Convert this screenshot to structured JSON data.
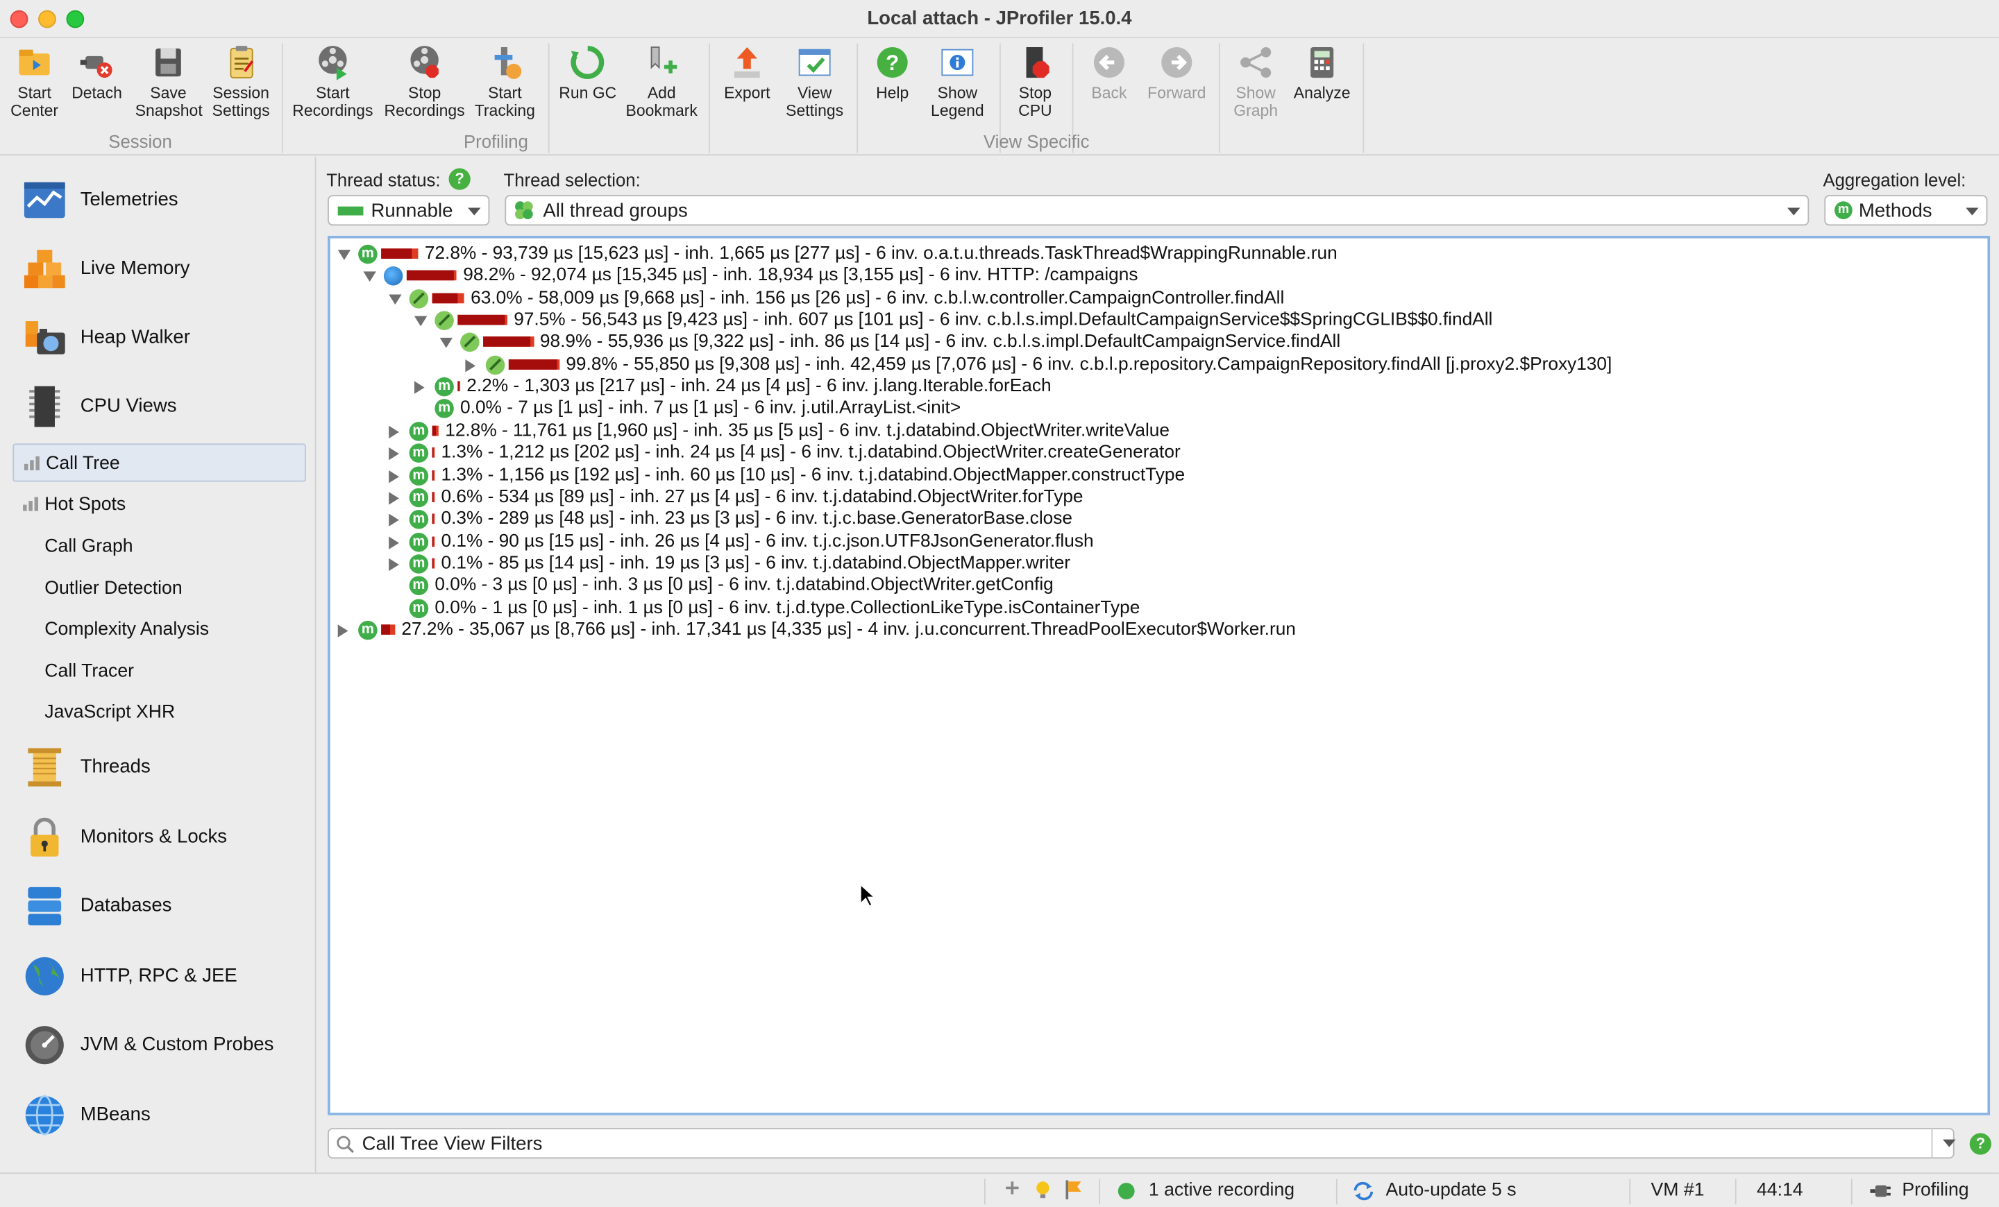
{
  "window": {
    "title": "Local attach - JProfiler 15.0.4"
  },
  "toolbar": {
    "buttons": [
      {
        "label": "Start\nCenter",
        "icon": "folder-icon"
      },
      {
        "label": "Detach",
        "icon": "detach-plug-icon"
      },
      {
        "label": "Save\nSnapshot",
        "icon": "save-disk-icon"
      },
      {
        "label": "Session\nSettings",
        "icon": "settings-clipboard-icon"
      },
      {
        "label": "Start\nRecordings",
        "icon": "film-reel-icon"
      },
      {
        "label": "Stop\nRecordings",
        "icon": "stop-film-icon"
      },
      {
        "label": "Start\nTracking",
        "icon": "tracking-icon"
      },
      {
        "label": "Run GC",
        "icon": "recycle-icon"
      },
      {
        "label": "Add\nBookmark",
        "icon": "bookmark-icon"
      },
      {
        "label": "Export",
        "icon": "export-icon"
      },
      {
        "label": "View\nSettings",
        "icon": "view-settings-icon"
      },
      {
        "label": "Help",
        "icon": "help-icon"
      },
      {
        "label": "Show\nLegend",
        "icon": "legend-icon"
      },
      {
        "label": "Stop\nCPU",
        "icon": "stop-cpu-icon"
      },
      {
        "label": "Back",
        "icon": "back-arrow-icon"
      },
      {
        "label": "Forward",
        "icon": "forward-arrow-icon"
      },
      {
        "label": "Show\nGraph",
        "icon": "graph-icon"
      },
      {
        "label": "Analyze",
        "icon": "calculator-icon"
      }
    ],
    "groups": {
      "session": "Session",
      "profiling": "Profiling",
      "view_specific": "View Specific"
    }
  },
  "sidebar": {
    "items": [
      {
        "label": "Telemetries",
        "icon": "telemetries-icon"
      },
      {
        "label": "Live Memory",
        "icon": "live-memory-icon"
      },
      {
        "label": "Heap Walker",
        "icon": "heap-walker-icon"
      },
      {
        "label": "CPU Views",
        "icon": "cpu-icon"
      },
      {
        "label": "Threads",
        "icon": "threads-icon"
      },
      {
        "label": "Monitors & Locks",
        "icon": "lock-icon"
      },
      {
        "label": "Databases",
        "icon": "database-icon"
      },
      {
        "label": "HTTP, RPC & JEE",
        "icon": "globe-icon"
      },
      {
        "label": "JVM & Custom Probes",
        "icon": "gauge-icon"
      },
      {
        "label": "MBeans",
        "icon": "mbeans-globe-icon"
      }
    ],
    "cpu_subitems": [
      {
        "label": "Call Tree",
        "selected": true
      },
      {
        "label": "Hot Spots"
      },
      {
        "label": "Call Graph"
      },
      {
        "label": "Outlier Detection"
      },
      {
        "label": "Complexity Analysis"
      },
      {
        "label": "Call Tracer"
      },
      {
        "label": "JavaScript XHR"
      }
    ]
  },
  "controls": {
    "thread_status_label": "Thread status:",
    "thread_status_value": "Runnable",
    "thread_selection_label": "Thread selection:",
    "thread_selection_value": "All thread groups",
    "aggregation_label": "Aggregation level:",
    "aggregation_value": "Methods",
    "help_glyph": "?"
  },
  "tree": {
    "rows": [
      {
        "text": "72.8% - 93,739 µs [15,623 µs] - inh. 1,665 µs [277 µs] - 6 inv. o.a.t.u.threads.TaskThread$WrappingRunnable.run",
        "percent": 72.8,
        "depth": 0,
        "expander": "open",
        "icon": "method"
      },
      {
        "text": "98.2% - 92,074 µs [15,345 µs] - inh. 18,934 µs [3,155 µs] - 6 inv. HTTP: /campaigns",
        "percent": 98.2,
        "depth": 1,
        "expander": "open",
        "icon": "http"
      },
      {
        "text": "63.0% - 58,009 µs [9,668 µs] - inh. 156 µs [26 µs] - 6 inv. c.b.l.w.controller.CampaignController.findAll",
        "percent": 63.0,
        "depth": 2,
        "expander": "open",
        "icon": "spring"
      },
      {
        "text": "97.5% - 56,543 µs [9,423 µs] - inh. 607 µs [101 µs] - 6 inv. c.b.l.s.impl.DefaultCampaignService$$SpringCGLIB$$0.findAll",
        "percent": 97.5,
        "depth": 3,
        "expander": "open",
        "icon": "spring"
      },
      {
        "text": "98.9% - 55,936 µs [9,322 µs] - inh. 86 µs [14 µs] - 6 inv. c.b.l.s.impl.DefaultCampaignService.findAll",
        "percent": 98.9,
        "depth": 4,
        "expander": "open",
        "icon": "spring"
      },
      {
        "text": "99.8% - 55,850 µs [9,308 µs] - inh. 42,459 µs [7,076 µs] - 6 inv. c.b.l.p.repository.CampaignRepository.findAll [j.proxy2.$Proxy130]",
        "percent": 99.8,
        "depth": 5,
        "expander": "closed",
        "icon": "spring"
      },
      {
        "text": "2.2% - 1,303 µs [217 µs] - inh. 24 µs [4 µs] - 6 inv. j.lang.Iterable.forEach",
        "percent": 2.2,
        "depth": 3,
        "expander": "closed",
        "icon": "method"
      },
      {
        "text": "0.0% - 7 µs [1 µs] - inh. 7 µs [1 µs] - 6 inv. j.util.ArrayList.<init>",
        "percent": 0.0,
        "depth": 3,
        "expander": "none",
        "icon": "method"
      },
      {
        "text": "12.8% - 11,761 µs [1,960 µs] - inh. 35 µs [5 µs] - 6 inv. t.j.databind.ObjectWriter.writeValue",
        "percent": 12.8,
        "depth": 2,
        "expander": "closed",
        "icon": "method"
      },
      {
        "text": "1.3% - 1,212 µs [202 µs] - inh. 24 µs [4 µs] - 6 inv. t.j.databind.ObjectWriter.createGenerator",
        "percent": 1.3,
        "depth": 2,
        "expander": "closed",
        "icon": "method"
      },
      {
        "text": "1.3% - 1,156 µs [192 µs] - inh. 60 µs [10 µs] - 6 inv. t.j.databind.ObjectMapper.constructType",
        "percent": 1.3,
        "depth": 2,
        "expander": "closed",
        "icon": "method"
      },
      {
        "text": "0.6% - 534 µs [89 µs] - inh. 27 µs [4 µs] - 6 inv. t.j.databind.ObjectWriter.forType",
        "percent": 0.6,
        "depth": 2,
        "expander": "closed",
        "icon": "method"
      },
      {
        "text": "0.3% - 289 µs [48 µs] - inh. 23 µs [3 µs] - 6 inv. t.j.c.base.GeneratorBase.close",
        "percent": 0.3,
        "depth": 2,
        "expander": "closed",
        "icon": "method"
      },
      {
        "text": "0.1% - 90 µs [15 µs] - inh. 26 µs [4 µs] - 6 inv. t.j.c.json.UTF8JsonGenerator.flush",
        "percent": 0.1,
        "depth": 2,
        "expander": "closed",
        "icon": "method"
      },
      {
        "text": "0.1% - 85 µs [14 µs] - inh. 19 µs [3 µs] - 6 inv. t.j.databind.ObjectMapper.writer",
        "percent": 0.1,
        "depth": 2,
        "expander": "closed",
        "icon": "method"
      },
      {
        "text": "0.0% - 3 µs [0 µs] - inh. 3 µs [0 µs] - 6 inv. t.j.databind.ObjectWriter.getConfig",
        "percent": 0.0,
        "depth": 2,
        "expander": "none",
        "icon": "method"
      },
      {
        "text": "0.0% - 1 µs [0 µs] - inh. 1 µs [0 µs] - 6 inv. t.j.d.type.CollectionLikeType.isContainerType",
        "percent": 0.0,
        "depth": 2,
        "expander": "none",
        "icon": "method"
      },
      {
        "text": "27.2% - 35,067 µs [8,766 µs] - inh. 17,341 µs [4,335 µs] - 4 inv. j.u.concurrent.ThreadPoolExecutor$Worker.run",
        "percent": 27.2,
        "depth": 0,
        "expander": "closed",
        "icon": "method"
      }
    ]
  },
  "filter": {
    "placeholder": "Call Tree View Filters"
  },
  "statusbar": {
    "recording": "1 active recording",
    "auto_update": "Auto-update 5 s",
    "vm": "VM #1",
    "time": "44:14",
    "mode": "Profiling"
  },
  "colors": {
    "accent": "#8ab4e6",
    "bar_dark": "#a50d0d",
    "bar_light": "#e03a22",
    "method_green": "#3fae49"
  }
}
